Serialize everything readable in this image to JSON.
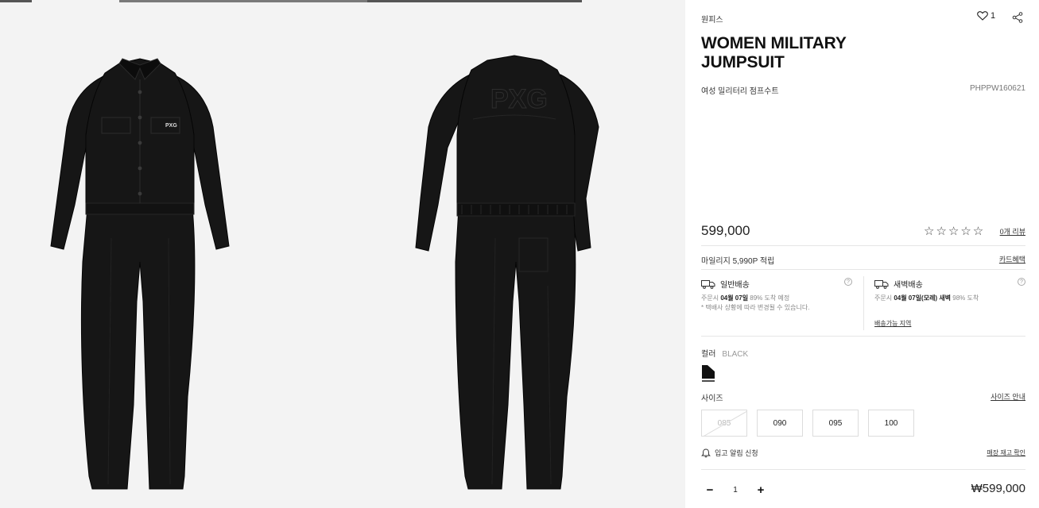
{
  "product": {
    "category": "원피스",
    "wish_count": "1",
    "title": "WOMEN MILITARY JUMPSUIT",
    "subtitle": "여성 밀리터리 점프수트",
    "code": "PHPPW160621",
    "price": "599,000",
    "stars": "☆☆☆☆☆",
    "reviews_label": "0개 리뷰"
  },
  "benefits": {
    "mileage": "마일리지 5,990P 적립",
    "card_benefit": "카드혜택"
  },
  "shipping": {
    "standard": {
      "title": "일반배송",
      "line1_prefix": "주문시 ",
      "line1_date": "04월 07일",
      "line1_suffix": " 89% 도착 예정",
      "note": "* 택배사 상황에 따라 변경될 수 있습니다."
    },
    "dawn": {
      "title": "새벽배송",
      "line1_prefix": "주문시 ",
      "line1_date": "04월 07일(모레) 새벽",
      "line1_suffix": " 98% 도착",
      "area_link": "배송가능 지역"
    },
    "help": "?"
  },
  "color": {
    "label": "컬러",
    "value": "BLACK",
    "swatch_hex": "#111111"
  },
  "size": {
    "label": "사이즈",
    "guide_link": "사이즈 안내",
    "options": [
      "085",
      "090",
      "095",
      "100"
    ],
    "sold_out": [
      "085"
    ]
  },
  "restock": {
    "label": "입고 알림 신청",
    "store_stock": "매장 재고 확인"
  },
  "quantity": {
    "minus": "−",
    "value": "1",
    "plus": "+"
  },
  "total": "₩599,000",
  "gallery": {
    "front_logo": "PXG",
    "back_logo": "PXG"
  },
  "colors": {
    "garment": "#161616",
    "gallery_bg": "#f3f3f3",
    "divider": "#e6e6e6"
  }
}
